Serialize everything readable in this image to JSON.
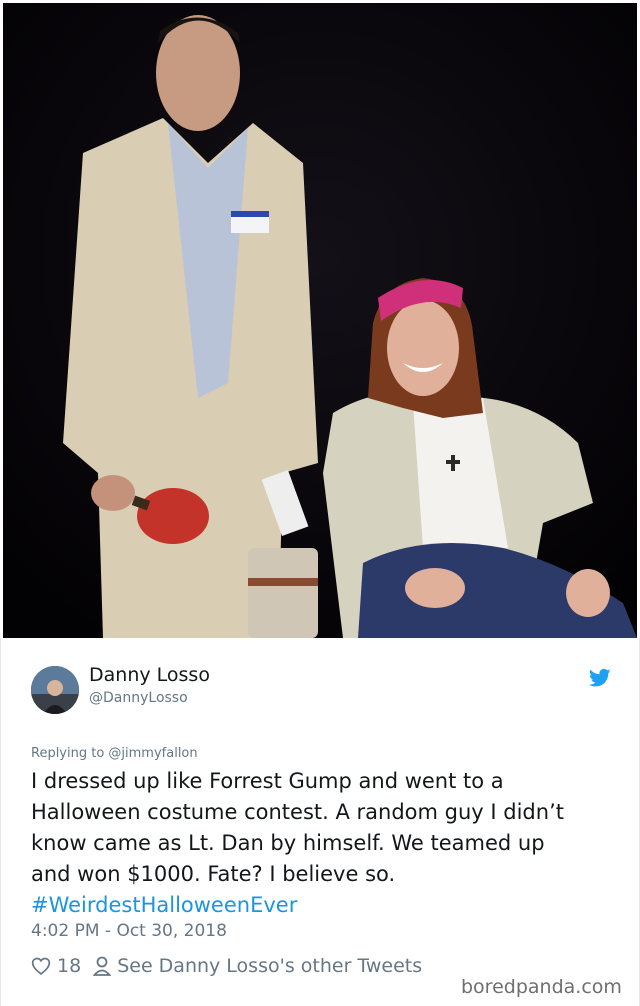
{
  "photo": {
    "description_icon": "costume-photo"
  },
  "tweet": {
    "author_name": "Danny Losso",
    "author_handle": "@DannyLosso",
    "replying_to": "Replying to @jimmyfallon",
    "body_lines": [
      "I dressed up like Forrest Gump and went to a",
      "Halloween costume contest. A random guy I didn’t",
      "know came as Lt. Dan by himself. We teamed up",
      "and won $1000. Fate? I believe so."
    ],
    "hashtag": "#WeirdestHalloweenEver",
    "timestamp": "4:02 PM - Oct 30, 2018",
    "like_count": "18",
    "see_other": "See Danny Losso's other Tweets"
  },
  "watermark": "boredpanda.com",
  "colors": {
    "accent": "#1b95e0",
    "muted": "#657786",
    "text": "#14171a"
  }
}
